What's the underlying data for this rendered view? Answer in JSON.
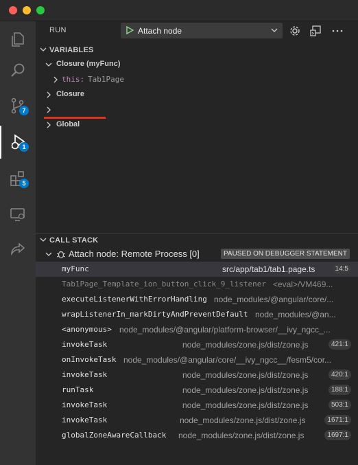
{
  "window": {
    "title_hidden": ""
  },
  "activity_bar": {
    "items": [
      {
        "name": "explorer",
        "icon": "files-icon"
      },
      {
        "name": "search",
        "icon": "search-icon"
      },
      {
        "name": "source-control",
        "icon": "source-control-icon",
        "badge": "7"
      },
      {
        "name": "run-debug",
        "icon": "debug-icon",
        "badge": "1",
        "active": true
      },
      {
        "name": "extensions",
        "icon": "extensions-icon",
        "badge": "5"
      },
      {
        "name": "remote-explorer",
        "icon": "remote-icon"
      },
      {
        "name": "live-share",
        "icon": "share-icon"
      }
    ]
  },
  "toolbar": {
    "run_label": "RUN",
    "config_name": "Attach node"
  },
  "variables": {
    "header": "VARIABLES",
    "closure_myfunc": "Closure (myFunc)",
    "this_name": "this:",
    "this_value": "Tab1Page",
    "closure": "Closure",
    "empty": "",
    "global": "Global"
  },
  "call_stack": {
    "header": "CALL STACK",
    "session": "Attach node: Remote Process [0]",
    "paused": "PAUSED ON DEBUGGER STATEMENT",
    "frames": [
      {
        "fn": "myFunc",
        "src": "src/app/tab1/tab1.page.ts",
        "pos": "14:5"
      },
      {
        "fn": "Tab1Page_Template_ion_button_click_9_listener",
        "src": "<eval>/VM469...",
        "pos": ""
      },
      {
        "fn": "executeListenerWithErrorHandling",
        "src": "node_modules/@angular/core/...",
        "pos": ""
      },
      {
        "fn": "wrapListenerIn_markDirtyAndPreventDefault",
        "src": "node_modules/@an...",
        "pos": ""
      },
      {
        "fn": "<anonymous>",
        "src": "node_modules/@angular/platform-browser/__ivy_ngcc_...",
        "pos": ""
      },
      {
        "fn": "invokeTask",
        "src": "node_modules/zone.js/dist/zone.js",
        "pos": "421:1"
      },
      {
        "fn": "onInvokeTask",
        "src": "node_modules/@angular/core/__ivy_ngcc__/fesm5/cor...",
        "pos": ""
      },
      {
        "fn": "invokeTask",
        "src": "node_modules/zone.js/dist/zone.js",
        "pos": "420:1"
      },
      {
        "fn": "runTask",
        "src": "node_modules/zone.js/dist/zone.js",
        "pos": "188:1"
      },
      {
        "fn": "invokeTask",
        "src": "node_modules/zone.js/dist/zone.js",
        "pos": "503:1"
      },
      {
        "fn": "invokeTask",
        "src": "node_modules/zone.js/dist/zone.js",
        "pos": "1671:1"
      },
      {
        "fn": "globalZoneAwareCallback",
        "src": "node_modules/zone.js/dist/zone.js",
        "pos": "1697:1"
      }
    ]
  },
  "colors": {
    "accent": "#007acc",
    "play": "#89d185",
    "underline": "#e0311b"
  }
}
